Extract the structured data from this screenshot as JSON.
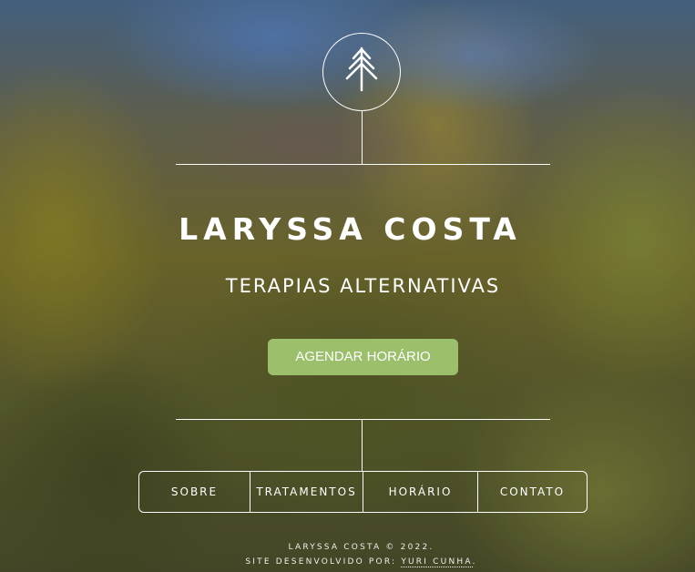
{
  "brand": {
    "logo_icon": "tree-icon",
    "name": "LARYSSA COSTA",
    "tagline": "TERAPIAS ALTERNATIVAS"
  },
  "cta": {
    "label": "AGENDAR HORÁRIO"
  },
  "nav": {
    "items": [
      {
        "label": "SOBRE"
      },
      {
        "label": "TRATAMENTOS"
      },
      {
        "label": "HORÁRIO"
      },
      {
        "label": "CONTATO"
      }
    ]
  },
  "footer": {
    "copyright": "LARYSSA COSTA © 2022.",
    "credit_prefix": "SITE DESENVOLVIDO POR: ",
    "credit_link": "YURI CUNHA",
    "credit_suffix": "."
  },
  "colors": {
    "accent": "#9bbf6a",
    "line": "#ffffff"
  }
}
